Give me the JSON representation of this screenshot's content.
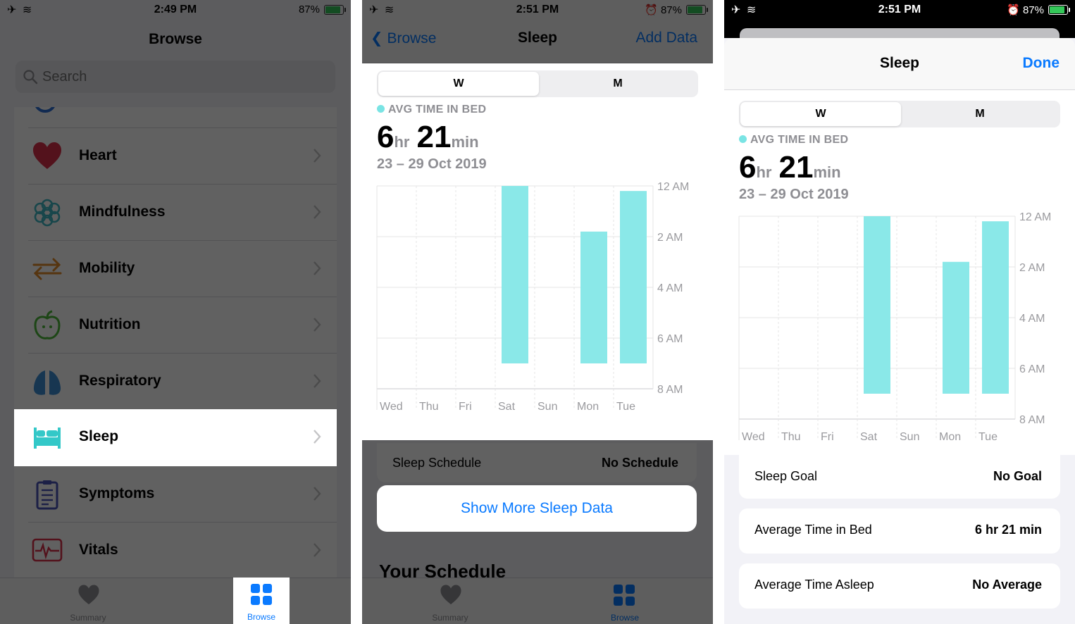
{
  "colors": {
    "accent": "#0a7aff",
    "sleep_bar": "#8ae8e8",
    "sleep_icon": "#33c8c8",
    "heart": "#d9304a"
  },
  "panel1": {
    "status": {
      "time": "2:49 PM",
      "battery": "87%"
    },
    "title": "Browse",
    "search_placeholder": "Search",
    "categories": [
      {
        "label": "Heart",
        "icon": "heart-icon"
      },
      {
        "label": "Mindfulness",
        "icon": "flower-icon"
      },
      {
        "label": "Mobility",
        "icon": "arrows-icon"
      },
      {
        "label": "Nutrition",
        "icon": "apple-icon"
      },
      {
        "label": "Respiratory",
        "icon": "lungs-icon"
      },
      {
        "label": "Sleep",
        "icon": "bed-icon",
        "selected": true
      },
      {
        "label": "Symptoms",
        "icon": "clipboard-icon"
      },
      {
        "label": "Vitals",
        "icon": "heartbeat-icon"
      }
    ],
    "tabs": [
      {
        "label": "Summary"
      },
      {
        "label": "Browse",
        "selected": true
      }
    ]
  },
  "panel2": {
    "status": {
      "time": "2:51 PM",
      "battery": "87%"
    },
    "nav": {
      "back": "Browse",
      "title": "Sleep",
      "action": "Add Data"
    },
    "segments": [
      "W",
      "M"
    ],
    "metric_label": "AVG TIME IN BED",
    "metric": {
      "hours": "6",
      "hr_unit": "hr",
      "minutes": "21",
      "min_unit": "min"
    },
    "date_range": "23 – 29 Oct 2019",
    "schedule": {
      "key": "Sleep Schedule",
      "value": "No Schedule"
    },
    "show_more": "Show More Sleep Data",
    "section_heading": "Your Schedule",
    "tabs": [
      {
        "label": "Summary"
      },
      {
        "label": "Browse",
        "selected": true
      }
    ]
  },
  "panel3": {
    "status": {
      "time": "2:51 PM",
      "battery": "87%"
    },
    "title": "Sleep",
    "done": "Done",
    "segments": [
      "W",
      "M"
    ],
    "metric_label": "AVG TIME IN BED",
    "metric": {
      "hours": "6",
      "hr_unit": "hr",
      "minutes": "21",
      "min_unit": "min"
    },
    "date_range": "23 – 29 Oct 2019",
    "rows": [
      {
        "key": "Sleep Goal",
        "value": "No Goal"
      },
      {
        "key": "Average Time in Bed",
        "value": "6 hr 21 min"
      },
      {
        "key": "Average Time Asleep",
        "value": "No Average"
      }
    ]
  },
  "chart_data": {
    "type": "bar",
    "categories": [
      "Wed",
      "Thu",
      "Fri",
      "Sat",
      "Sun",
      "Mon",
      "Tue"
    ],
    "y_tick_labels": [
      "12 AM",
      "2 AM",
      "4 AM",
      "6 AM",
      "8 AM"
    ],
    "y_unit": "hours after midnight",
    "ylim": [
      0,
      8
    ],
    "y_inverted": true,
    "series": [
      {
        "start": [
          null,
          null,
          null,
          0.0,
          null,
          1.8,
          0.2
        ],
        "end": [
          null,
          null,
          null,
          7.0,
          null,
          7.0,
          7.0
        ]
      }
    ],
    "grid": true
  }
}
